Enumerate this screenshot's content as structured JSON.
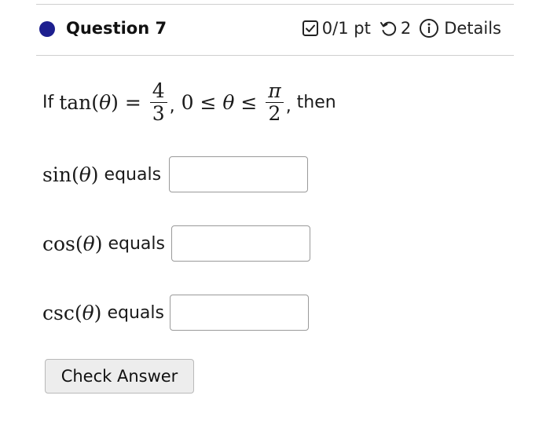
{
  "question": {
    "title": "Question 7",
    "status_color": "#1d1f8f",
    "score": "0/1 pt",
    "attempts": "2",
    "details_label": "Details",
    "icons": [
      "checkbox-icon",
      "retry-icon",
      "info-icon"
    ]
  },
  "stem": {
    "if": "If",
    "fn": "tan",
    "lparen": "(",
    "theta": "θ",
    "rparen": ")",
    "eq": " = ",
    "frac1_num": "4",
    "frac1_den": "3",
    "comma1": ",",
    "ineq_start": " 0 ≤ ",
    "ineq_theta": "θ",
    "ineq_end": " ≤ ",
    "frac2_num": "π",
    "frac2_den": "2",
    "comma2": ",",
    "then": " then"
  },
  "rows": [
    {
      "fn": "sin",
      "theta": "θ",
      "label": "equals",
      "value": ""
    },
    {
      "fn": "cos",
      "theta": "θ",
      "label": "equals",
      "value": ""
    },
    {
      "fn": "csc",
      "theta": "θ",
      "label": "equals",
      "value": ""
    }
  ],
  "check_button": "Check Answer"
}
